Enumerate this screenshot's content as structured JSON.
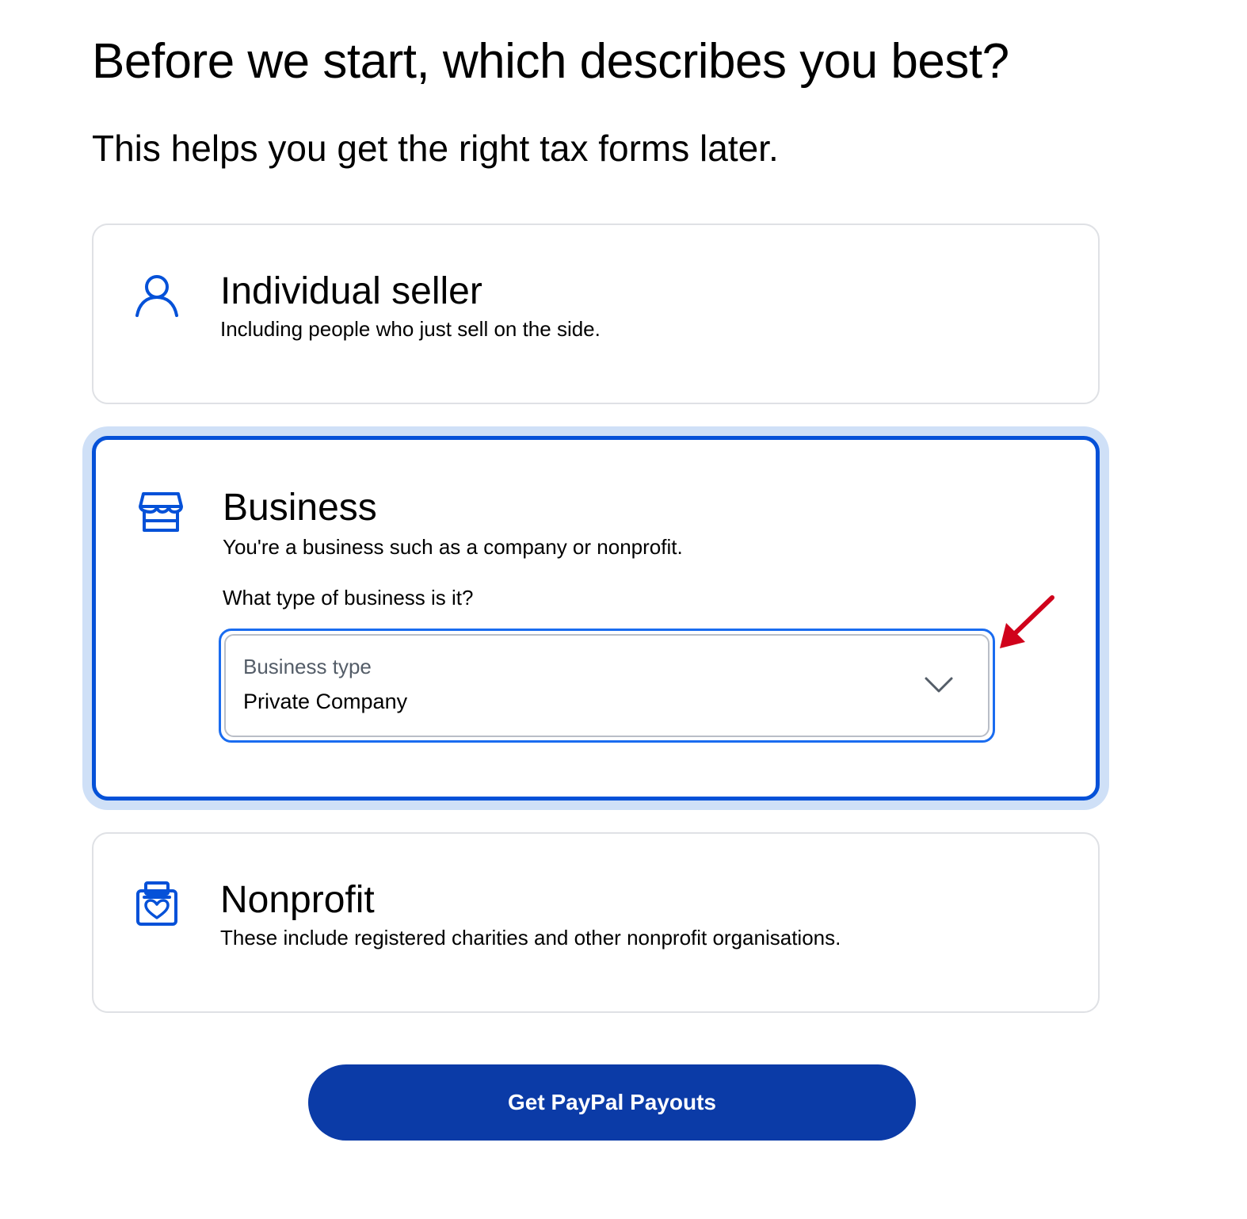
{
  "header": {
    "title": "Before we start, which describes you best?",
    "subtitle": "This helps you get the right tax forms later."
  },
  "options": {
    "individual": {
      "title": "Individual seller",
      "description": "Including people who just sell on the side.",
      "icon": "person-icon",
      "selected": false
    },
    "business": {
      "title": "Business",
      "description": "You're a business such as a company or nonprofit.",
      "icon": "storefront-icon",
      "selected": true,
      "question": "What type of business is it?",
      "select": {
        "label": "Business type",
        "value": "Private Company",
        "icon": "chevron-down-icon"
      }
    },
    "nonprofit": {
      "title": "Nonprofit",
      "description": "These include registered charities and other nonprofit organisations.",
      "icon": "donation-box-icon",
      "selected": false
    }
  },
  "cta": {
    "label": "Get PayPal Payouts"
  },
  "colors": {
    "accent": "#0551d8",
    "focus_ring": "#1a6cf0",
    "selected_halo": "#cfe0f7",
    "button": "#0b3ba7",
    "annotation_arrow": "#d0021b"
  }
}
